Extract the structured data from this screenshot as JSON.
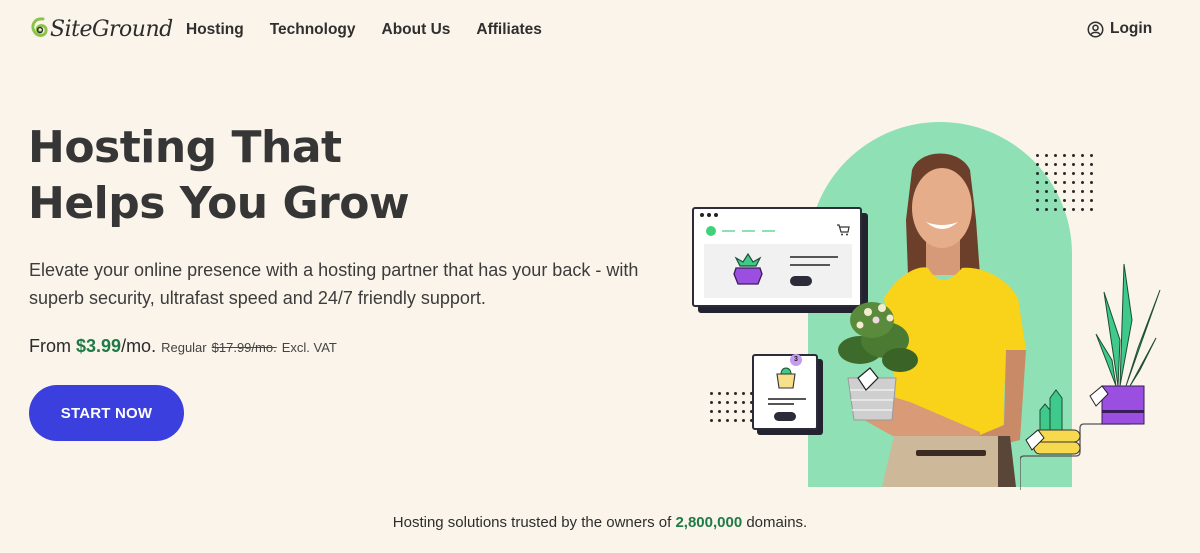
{
  "header": {
    "logo": {
      "text": "SiteGround",
      "icon": "siteground-swirl-icon"
    },
    "nav": [
      {
        "label": "Hosting"
      },
      {
        "label": "Technology"
      },
      {
        "label": "About Us"
      },
      {
        "label": "Affiliates"
      }
    ],
    "login": {
      "label": "Login",
      "icon": "user-circle-icon"
    }
  },
  "hero": {
    "title_line1": "Hosting That",
    "title_line2": "Helps You Grow",
    "subtitle": "Elevate your online presence with a hosting partner that has your back - with superb security, ultrafast speed and 24/7 friendly support.",
    "price": {
      "from_label": "From",
      "amount": "$3.99",
      "period": "/mo.",
      "regular_label": "Regular",
      "regular_price": "$17.99/mo.",
      "tax_note": "Excl. VAT"
    },
    "cta_label": "START NOW"
  },
  "illustration": {
    "cart_badge_count": "3",
    "alt": "Smiling woman in yellow shirt holding a potted plant with e-commerce shop illustrations"
  },
  "trust": {
    "prefix": "Hosting solutions trusted by the owners of",
    "count": "2,800,000",
    "suffix": "domains."
  },
  "colors": {
    "background": "#fbf4ea",
    "accent_green": "#1f7a45",
    "cta_blue": "#3b3fdd",
    "arch_mint": "#8fe0b4",
    "text_dark": "#363636"
  }
}
